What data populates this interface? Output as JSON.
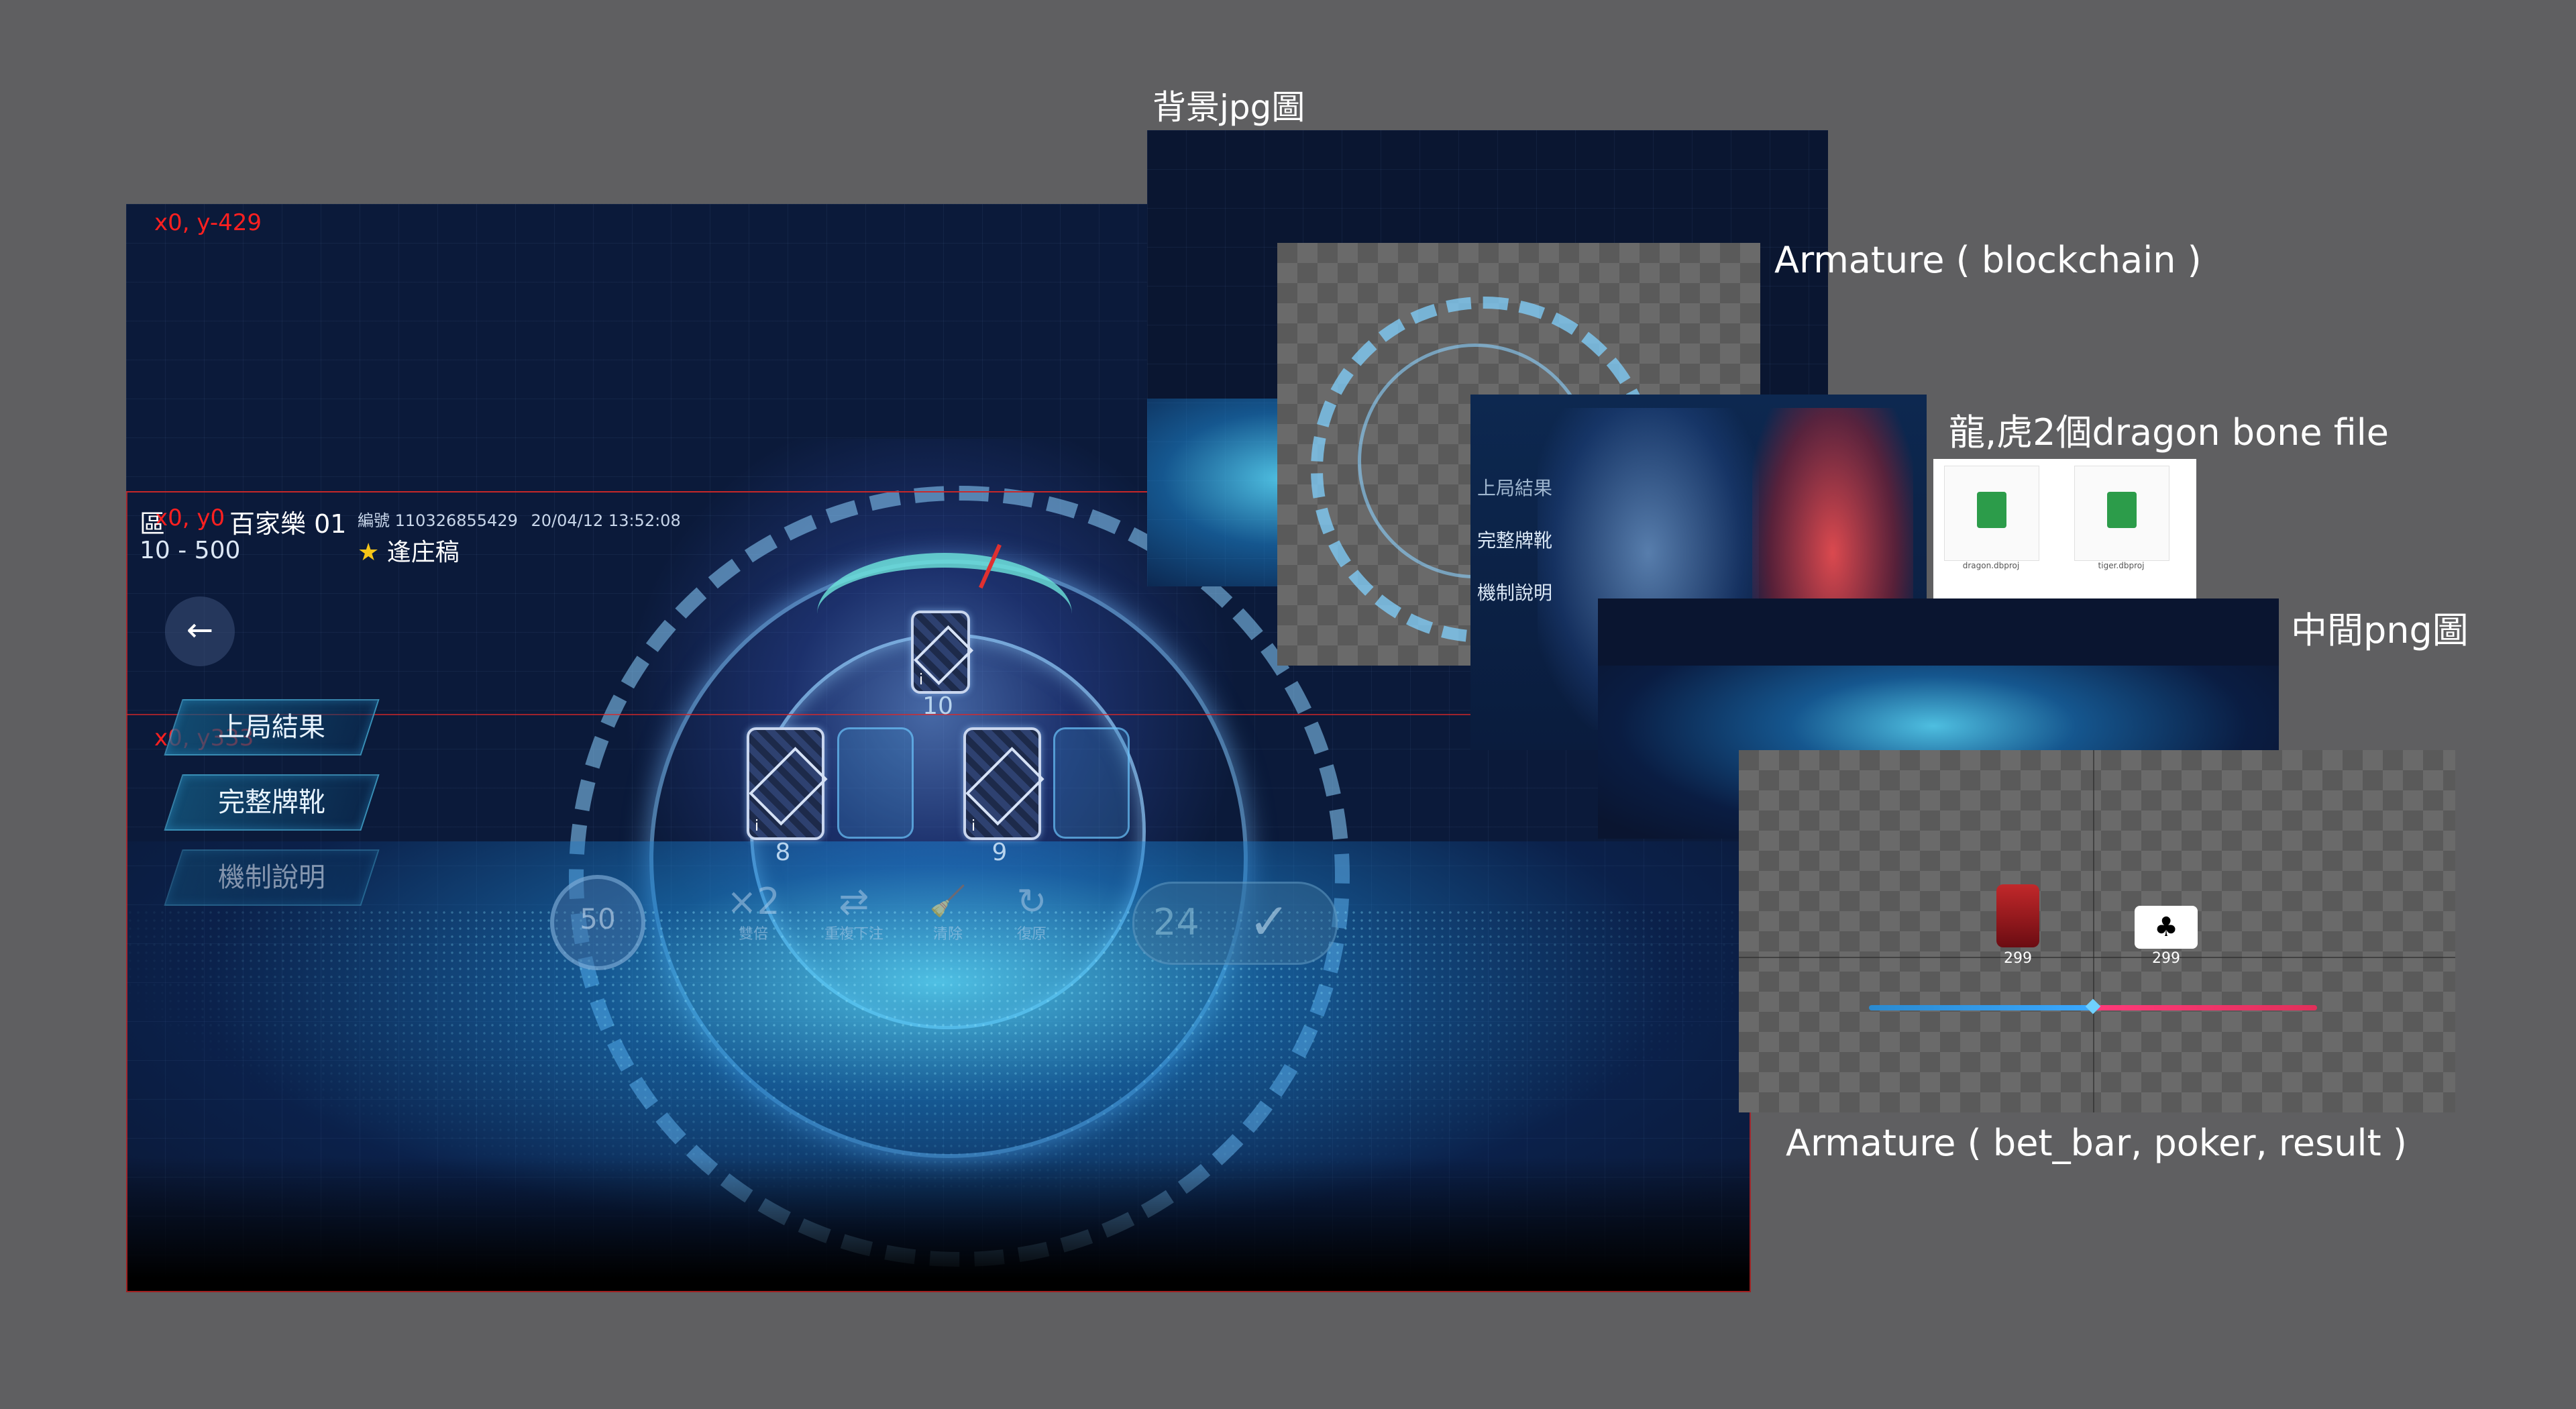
{
  "coords": {
    "top": "x0, y-429",
    "origin": "x0, y0",
    "mid": "x0, y333"
  },
  "game": {
    "title": "百家樂 01",
    "title_prefix": "區",
    "range": "10 - 500",
    "serial": "編號 110326855429",
    "datetime": "20/04/12 13:52:08",
    "dealer": "逢庄稿",
    "back_icon": "arrow-left-icon",
    "side_buttons": [
      "上局結果",
      "完整牌靴",
      "機制說明"
    ],
    "top_card_value": "10",
    "left_card_value": "8",
    "right_card_value": "9",
    "chip": "50",
    "timer": "24",
    "controls": [
      {
        "glyph": "×2",
        "label": "雙倍"
      },
      {
        "glyph": "⇄",
        "label": "重複下注"
      },
      {
        "glyph": "🧹",
        "label": "清除"
      },
      {
        "glyph": "↻",
        "label": "復原"
      }
    ]
  },
  "layers": {
    "bg_label": "背景jpg圖",
    "armature_label": "Armature ( blockchain )",
    "dragon_label": "龍,虎2個dragon bone file",
    "png_label": "中間png圖",
    "bet_label": "Armature ( bet_bar,  poker,  result )",
    "mini_buttons": [
      "上局結果",
      "完整牌靴",
      "機制說明"
    ],
    "files": [
      {
        "name": "dragon.dbproj"
      },
      {
        "name": "tiger.dbproj"
      }
    ],
    "bet_left_value": "299",
    "bet_right_value": "299"
  }
}
